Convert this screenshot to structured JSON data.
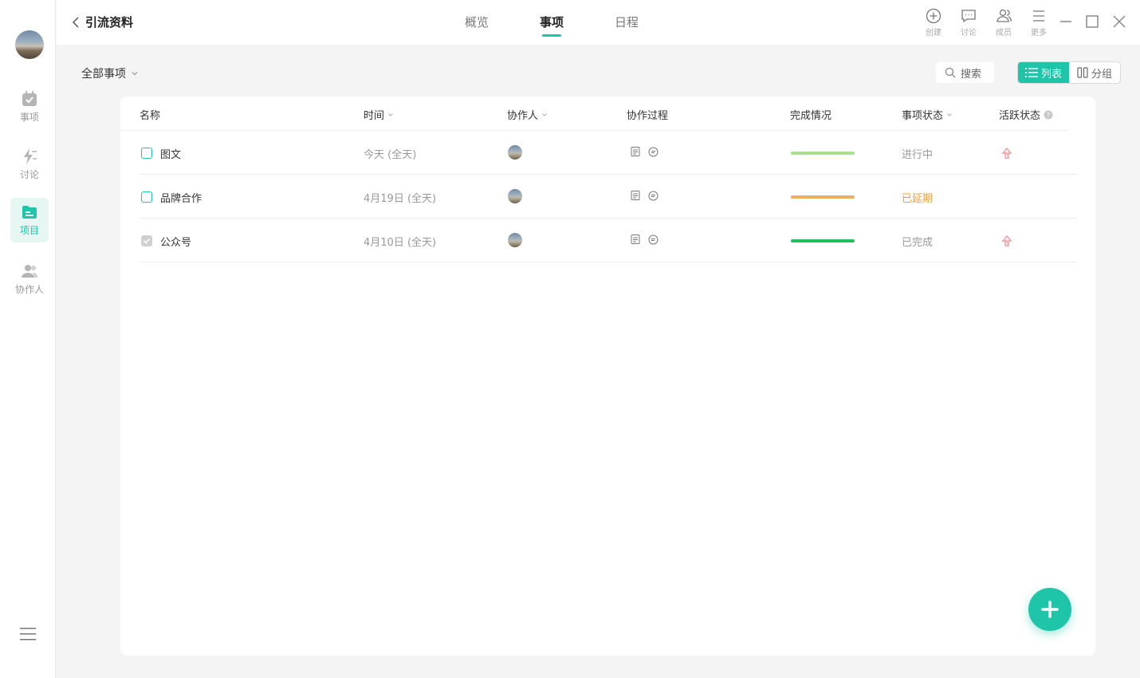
{
  "sidebar": {
    "items": [
      {
        "label": "事项",
        "icon": "calendar-check-icon"
      },
      {
        "label": "讨论",
        "icon": "lightning-icon"
      },
      {
        "label": "项目",
        "icon": "folder-icon"
      },
      {
        "label": "协作人",
        "icon": "users-icon"
      }
    ],
    "active": "项目"
  },
  "header": {
    "title": "引流资料",
    "tabs": [
      {
        "label": "概览"
      },
      {
        "label": "事项"
      },
      {
        "label": "日程"
      }
    ],
    "active_tab": "事项",
    "tools": [
      {
        "label": "创建",
        "icon": "plus-circle-icon"
      },
      {
        "label": "讨论",
        "icon": "chat-icon"
      },
      {
        "label": "成员",
        "icon": "members-icon"
      },
      {
        "label": "更多",
        "icon": "menu-icon"
      }
    ]
  },
  "toolbar": {
    "filter_label": "全部事项",
    "search_label": "搜索",
    "view_list": "列表",
    "view_group": "分组"
  },
  "table": {
    "columns": {
      "name": "名称",
      "time": "时间",
      "collaborator": "协作人",
      "process": "协作过程",
      "completion": "完成情况",
      "status": "事项状态",
      "activity": "活跃状态"
    },
    "rows": [
      {
        "title": "图文",
        "time": "今天 (全天)",
        "status": "进行中",
        "done": false,
        "bar_color": "#a8e08f",
        "status_color": "#999999",
        "active": true
      },
      {
        "title": "品牌合作",
        "time": "4月19日 (全天)",
        "status": "已延期",
        "done": false,
        "bar_color": "#e9b25a",
        "status_color": "#e9a23b",
        "active": false
      },
      {
        "title": "公众号",
        "time": "4月10日 (全天)",
        "status": "已完成",
        "done": true,
        "bar_color": "#1fbf5a",
        "status_color": "#999999",
        "active": true
      }
    ]
  },
  "colors": {
    "accent": "#1fc5a8"
  }
}
